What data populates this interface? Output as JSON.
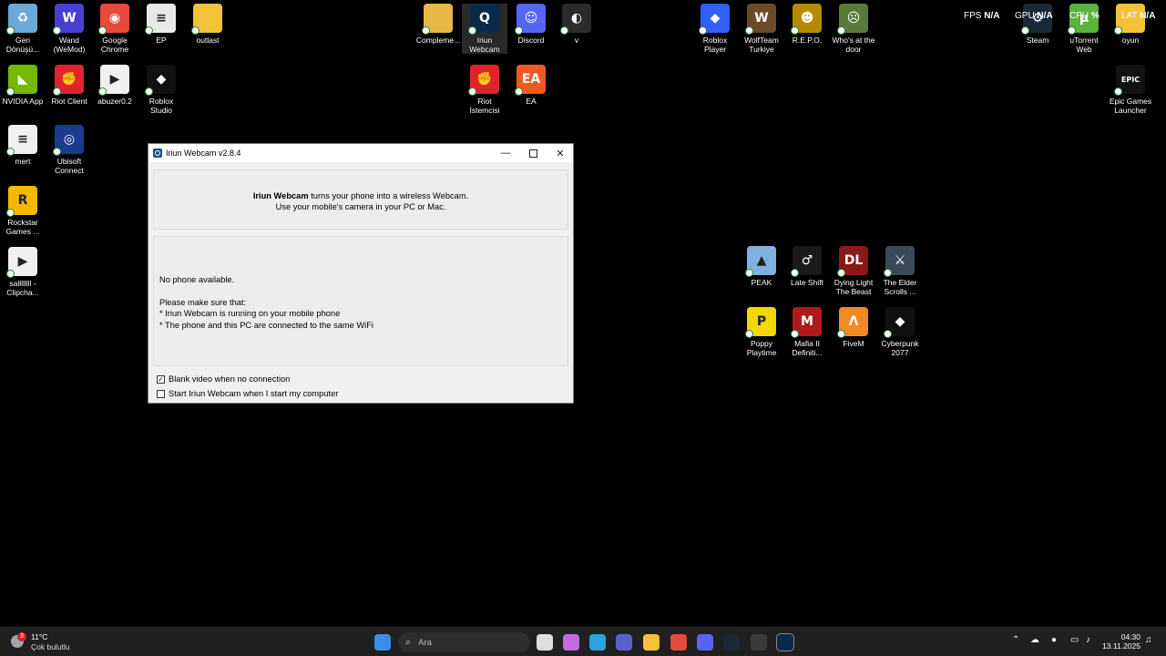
{
  "desktop": {
    "icons": [
      {
        "id": "recycle",
        "label": "Geri\nDönüşü...",
        "color": "#6aa9d8",
        "glyph": "♻"
      },
      {
        "id": "wand",
        "label": "Wand\n(WeMod)",
        "color": "#4a3fd1",
        "glyph": "W"
      },
      {
        "id": "chrome",
        "label": "Google\nChrome",
        "color": "#e54a3c",
        "glyph": "◉"
      },
      {
        "id": "ep",
        "label": "EP",
        "color": "#e8e8e8",
        "glyph": "≡"
      },
      {
        "id": "outlast",
        "label": "outlast",
        "color": "#f2c23b",
        "glyph": ""
      },
      {
        "id": "nvidia",
        "label": "NVIDIA App",
        "color": "#76b900",
        "glyph": "◣"
      },
      {
        "id": "riot",
        "label": "Riot Client",
        "color": "#e0232c",
        "glyph": "✊"
      },
      {
        "id": "abuzer",
        "label": "abuzer0.2",
        "color": "#f0f0f0",
        "glyph": "▶"
      },
      {
        "id": "roblox-studio",
        "label": "Roblox\nStudio",
        "color": "#111111",
        "glyph": "◆"
      },
      {
        "id": "mert",
        "label": "mert",
        "color": "#f0f0f0",
        "glyph": "≡"
      },
      {
        "id": "ubisoft",
        "label": "Ubisoft\nConnect",
        "color": "#1b3b8f",
        "glyph": "◎"
      },
      {
        "id": "rockstar",
        "label": "Rockstar\nGames ...",
        "color": "#f5b800",
        "glyph": "R"
      },
      {
        "id": "clipchamp",
        "label": "sallllllll -\nClipcha...",
        "color": "#f0f0f0",
        "glyph": "▶"
      },
      {
        "id": "complement",
        "label": "Compleme...",
        "color": "#e6b845",
        "glyph": ""
      },
      {
        "id": "iriun",
        "label": "Iriun\nWebcam",
        "color": "#0b2a4a",
        "glyph": "Q"
      },
      {
        "id": "discord",
        "label": "Discord",
        "color": "#5865f2",
        "glyph": "☺"
      },
      {
        "id": "obs",
        "label": "v",
        "color": "#2b2b2b",
        "glyph": "◐"
      },
      {
        "id": "riot-istemcisi",
        "label": "Riot İstemcisi",
        "color": "#e0232c",
        "glyph": "✊"
      },
      {
        "id": "ea",
        "label": "EA",
        "color": "#f05a22",
        "glyph": "EA"
      },
      {
        "id": "roblox-player",
        "label": "Roblox Player",
        "color": "#335fff",
        "glyph": "◆"
      },
      {
        "id": "wolfteam",
        "label": "WolfTeam\nTurkiye",
        "color": "#6b4a2a",
        "glyph": "W"
      },
      {
        "id": "repo",
        "label": "R.E.P.O.",
        "color": "#b58a00",
        "glyph": "☻"
      },
      {
        "id": "whos-at-door",
        "label": "Who's at the\ndoor",
        "color": "#5a7a3a",
        "glyph": "☹"
      },
      {
        "id": "steam",
        "label": "Steam",
        "color": "#1b2838",
        "glyph": "⚙"
      },
      {
        "id": "utorrent",
        "label": "uTorrent Web",
        "color": "#5bb33a",
        "glyph": "μ"
      },
      {
        "id": "oyun",
        "label": "oyun",
        "color": "#f2c23b",
        "glyph": ""
      },
      {
        "id": "epic",
        "label": "Epic Games\nLauncher",
        "color": "#121212",
        "glyph": "EPIC"
      },
      {
        "id": "peak",
        "label": "PEAK",
        "color": "#7fb0e0",
        "glyph": "▲"
      },
      {
        "id": "late-shift",
        "label": "Late Shift",
        "color": "#1a1a1a",
        "glyph": "♂"
      },
      {
        "id": "dying-light",
        "label": "Dying Light\nThe Beast",
        "color": "#8a1a1a",
        "glyph": "DL"
      },
      {
        "id": "elder-scrolls",
        "label": "The Elder\nScrolls ...",
        "color": "#3a4a5a",
        "glyph": "⚔"
      },
      {
        "id": "poppy",
        "label": "Poppy\nPlaytime",
        "color": "#f0d800",
        "glyph": "P"
      },
      {
        "id": "mafia",
        "label": "Mafia II\nDefiniti...",
        "color": "#b01a1a",
        "glyph": "M"
      },
      {
        "id": "fivem",
        "label": "FiveM",
        "color": "#f08a24",
        "glyph": "Λ"
      },
      {
        "id": "cyberpunk",
        "label": "Cyberpunk\n2077",
        "color": "#111111",
        "glyph": "◆"
      }
    ],
    "overlay": {
      "fps_label": "FPS",
      "fps_value": "N/A",
      "gpu_label": "GPU",
      "gpu_value": "N/A",
      "cpu_label": "CPU",
      "cpu_value": "%",
      "lat_label": "LAT",
      "lat_value": "N/A"
    }
  },
  "window": {
    "title": "Iriun Webcam v2.8.4",
    "intro_bold": "Iriun Webcam",
    "intro_rest": " turns your phone into a wireless Webcam.",
    "intro_line2": "Use your mobile's camera in your PC or Mac.",
    "status": "No phone available.",
    "hint_title": "Please make sure that:",
    "hint_1": "* Iriun Webcam is running on your mobile phone",
    "hint_2": "* The phone and this PC are connected to the same WiFi",
    "checkbox_blank": {
      "label": "Blank video when no connection",
      "checked": true
    },
    "checkbox_startup": {
      "label": "Start Iriun Webcam when I start my computer",
      "checked": false
    }
  },
  "taskbar": {
    "weather_temp": "11°C",
    "weather_desc": "Çok bulutlu",
    "weather_badge": "3",
    "search_placeholder": "Ara",
    "clock_time": "04:30",
    "clock_date": "13.11.2025",
    "pinned": [
      {
        "id": "start",
        "color": "#3d8ee6"
      },
      {
        "id": "widgets",
        "color": "#4a6a4a"
      },
      {
        "id": "task-view",
        "color": "#dddddd"
      },
      {
        "id": "copilot",
        "color": "#c26ae0"
      },
      {
        "id": "edge",
        "color": "#2aa2e0"
      },
      {
        "id": "teams",
        "color": "#5b5fc7"
      },
      {
        "id": "explorer",
        "color": "#f2c23b"
      },
      {
        "id": "chrome-tb",
        "color": "#e54a3c"
      },
      {
        "id": "discord-tb",
        "color": "#5865f2"
      },
      {
        "id": "steam-tb",
        "color": "#1b2838"
      },
      {
        "id": "obs-tb",
        "color": "#3a3a3a"
      },
      {
        "id": "iriun-tb",
        "color": "#0b2a4a"
      }
    ]
  }
}
